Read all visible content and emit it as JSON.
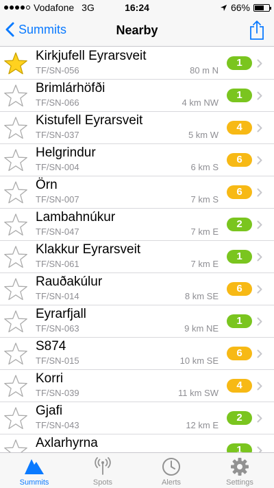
{
  "status": {
    "carrier": "Vodafone",
    "network": "3G",
    "time": "16:24",
    "battery": "66%",
    "battery_level": 0.66
  },
  "nav": {
    "back_label": "Summits",
    "title": "Nearby"
  },
  "colors": {
    "accent": "#0a7aff",
    "badge_green": "#7ac51f",
    "badge_yellow": "#f7b915",
    "star_yellow": "#ffd21f"
  },
  "summits": [
    {
      "name": "Kirkjufell Eyrarsveit",
      "ref": "TF/SN-056",
      "distance": "80 m N",
      "points": "1",
      "color": "green",
      "favorite": true
    },
    {
      "name": "Brimlárhöfði",
      "ref": "TF/SN-066",
      "distance": "4 km NW",
      "points": "1",
      "color": "green",
      "favorite": false
    },
    {
      "name": "Kistufell Eyrarsveit",
      "ref": "TF/SN-037",
      "distance": "5 km W",
      "points": "4",
      "color": "yellow",
      "favorite": false
    },
    {
      "name": "Helgrindur",
      "ref": "TF/SN-004",
      "distance": "6 km S",
      "points": "6",
      "color": "yellow",
      "favorite": false
    },
    {
      "name": "Örn",
      "ref": "TF/SN-007",
      "distance": "7 km S",
      "points": "6",
      "color": "yellow",
      "favorite": false
    },
    {
      "name": "Lambahnúkur",
      "ref": "TF/SN-047",
      "distance": "7 km E",
      "points": "2",
      "color": "green",
      "favorite": false
    },
    {
      "name": "Klakkur Eyrarsveit",
      "ref": "TF/SN-061",
      "distance": "7 km E",
      "points": "1",
      "color": "green",
      "favorite": false
    },
    {
      "name": "Rauðakúlur",
      "ref": "TF/SN-014",
      "distance": "8 km SE",
      "points": "6",
      "color": "yellow",
      "favorite": false
    },
    {
      "name": "Eyrarfjall",
      "ref": "TF/SN-063",
      "distance": "9 km NE",
      "points": "1",
      "color": "green",
      "favorite": false
    },
    {
      "name": "S874",
      "ref": "TF/SN-015",
      "distance": "10 km SE",
      "points": "6",
      "color": "yellow",
      "favorite": false
    },
    {
      "name": "Korri",
      "ref": "TF/SN-039",
      "distance": "11 km SW",
      "points": "4",
      "color": "yellow",
      "favorite": false
    },
    {
      "name": "Gjafi",
      "ref": "TF/SN-043",
      "distance": "12 km E",
      "points": "2",
      "color": "green",
      "favorite": false
    },
    {
      "name": "Axlarhyrna",
      "ref": "",
      "distance": "",
      "points": "1",
      "color": "green",
      "favorite": false
    }
  ],
  "tabs": [
    {
      "label": "Summits",
      "icon": "mountain-icon",
      "active": true
    },
    {
      "label": "Spots",
      "icon": "antenna-icon",
      "active": false
    },
    {
      "label": "Alerts",
      "icon": "clock-icon",
      "active": false
    },
    {
      "label": "Settings",
      "icon": "gear-icon",
      "active": false
    }
  ]
}
